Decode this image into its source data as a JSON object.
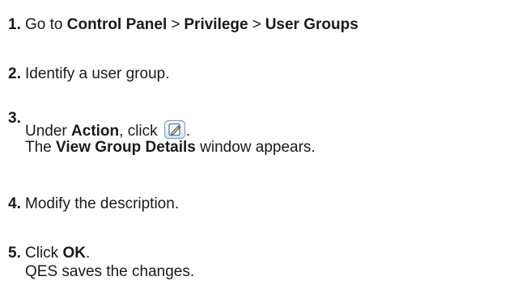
{
  "steps": [
    {
      "number": "1.",
      "prefix": "Go to ",
      "path": [
        "Control Panel",
        "Privilege",
        "User Groups"
      ],
      "separator": ">"
    },
    {
      "number": "2.",
      "text": "Identify a user group."
    },
    {
      "number": "3.",
      "line1_prefix": "Under ",
      "line1_bold": "Action",
      "line1_middle": ", click ",
      "line1_suffix": ".",
      "icon": "edit-icon",
      "line2_prefix": "The ",
      "line2_bold": "View Group Details",
      "line2_suffix": " window appears."
    },
    {
      "number": "4.",
      "text": "Modify the description."
    },
    {
      "number": "5.",
      "line1_prefix": "Click ",
      "line1_bold": "OK",
      "line1_suffix": ".",
      "line2": "QES saves the changes."
    }
  ],
  "colors": {
    "text": "#1a1a1a",
    "icon_border": "#8aa0b8",
    "icon_fill": "#ffffff",
    "icon_pencil": "#2b6cb0"
  }
}
